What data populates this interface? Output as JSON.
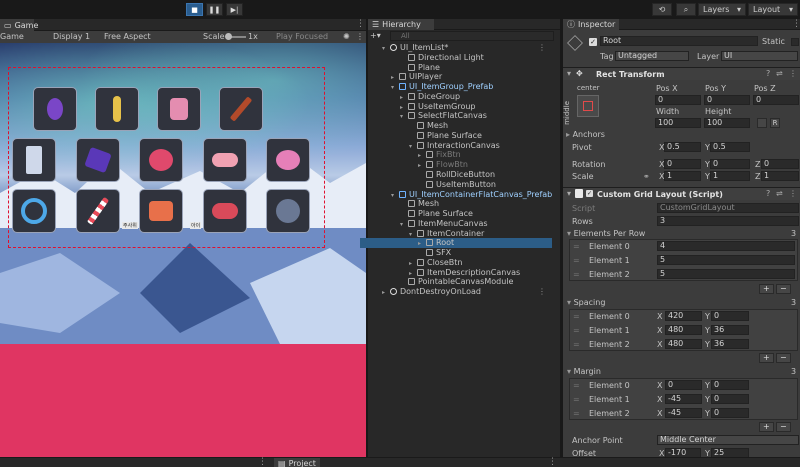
{
  "toolbar": {
    "layers_label": "Layers",
    "layout_label": "Layout"
  },
  "game": {
    "tab_label": "Game",
    "display": "Display 1",
    "aspect": "Free Aspect",
    "scale_label": "Scale",
    "scale_value": "1x",
    "play_focused": "Play Focused",
    "mode_label": "Game"
  },
  "items": {
    "rows": [
      [
        "potion",
        "spoon",
        "bottle",
        "brush"
      ],
      [
        "crystal",
        "gem",
        "cake",
        "candy",
        "ball"
      ],
      [
        "ring",
        "candy-cane",
        "cushion",
        "creature",
        "orb"
      ]
    ],
    "caption_a": "주사위",
    "caption_b": "아이"
  },
  "hierarchy": {
    "tab_label": "Hierarchy",
    "search_placeholder": "All",
    "rows": [
      {
        "label": "UI_ItemList*",
        "indent": 0,
        "arrow": "▾",
        "kind": "root",
        "sel": false,
        "dim": false
      },
      {
        "label": "Directional Light",
        "indent": 2,
        "arrow": "",
        "kind": "go",
        "sel": false,
        "dim": false
      },
      {
        "label": "Plane",
        "indent": 2,
        "arrow": "",
        "kind": "go",
        "sel": false,
        "dim": false
      },
      {
        "label": "UIPlayer",
        "indent": 1,
        "arrow": "▸",
        "kind": "go",
        "sel": false,
        "dim": false
      },
      {
        "label": "UI_ItemGroup_Prefab",
        "indent": 1,
        "arrow": "▾",
        "kind": "prefab",
        "sel": false,
        "dim": false
      },
      {
        "label": "DiceGroup",
        "indent": 2,
        "arrow": "▸",
        "kind": "go",
        "sel": false,
        "dim": false
      },
      {
        "label": "UseItemGroup",
        "indent": 2,
        "arrow": "▸",
        "kind": "go",
        "sel": false,
        "dim": false
      },
      {
        "label": "SelectFlatCanvas",
        "indent": 2,
        "arrow": "▾",
        "kind": "go",
        "sel": false,
        "dim": false
      },
      {
        "label": "Mesh",
        "indent": 3,
        "arrow": "",
        "kind": "go",
        "sel": false,
        "dim": false
      },
      {
        "label": "Plane Surface",
        "indent": 3,
        "arrow": "",
        "kind": "go",
        "sel": false,
        "dim": false
      },
      {
        "label": "InteractionCanvas",
        "indent": 3,
        "arrow": "▾",
        "kind": "go",
        "sel": false,
        "dim": false
      },
      {
        "label": "FixBtn",
        "indent": 4,
        "arrow": "▸",
        "kind": "go",
        "sel": false,
        "dim": true
      },
      {
        "label": "FlowBtn",
        "indent": 4,
        "arrow": "▸",
        "kind": "go",
        "sel": false,
        "dim": true
      },
      {
        "label": "RollDiceButton",
        "indent": 4,
        "arrow": "",
        "kind": "go",
        "sel": false,
        "dim": false
      },
      {
        "label": "UseItemButton",
        "indent": 4,
        "arrow": "",
        "kind": "go",
        "sel": false,
        "dim": false
      },
      {
        "label": "UI_ItemContainerFlatCanvas_Prefab",
        "indent": 1,
        "arrow": "▾",
        "kind": "prefab",
        "sel": false,
        "dim": false
      },
      {
        "label": "Mesh",
        "indent": 2,
        "arrow": "",
        "kind": "go",
        "sel": false,
        "dim": false
      },
      {
        "label": "Plane Surface",
        "indent": 2,
        "arrow": "",
        "kind": "go",
        "sel": false,
        "dim": false
      },
      {
        "label": "ItemMenuCanvas",
        "indent": 2,
        "arrow": "▾",
        "kind": "go",
        "sel": false,
        "dim": false
      },
      {
        "label": "ItemContainer",
        "indent": 3,
        "arrow": "▾",
        "kind": "go",
        "sel": false,
        "dim": false
      },
      {
        "label": "Root",
        "indent": 4,
        "arrow": "▸",
        "kind": "go",
        "sel": true,
        "dim": false
      },
      {
        "label": "SFX",
        "indent": 4,
        "arrow": "",
        "kind": "go",
        "sel": false,
        "dim": false
      },
      {
        "label": "CloseBtn",
        "indent": 3,
        "arrow": "▸",
        "kind": "go",
        "sel": false,
        "dim": false
      },
      {
        "label": "ItemDescriptionCanvas",
        "indent": 3,
        "arrow": "▸",
        "kind": "go",
        "sel": false,
        "dim": false
      },
      {
        "label": "PointableCanvasModule",
        "indent": 2,
        "arrow": "",
        "kind": "go",
        "sel": false,
        "dim": false
      },
      {
        "label": "DontDestroyOnLoad",
        "indent": 0,
        "arrow": "▸",
        "kind": "root",
        "sel": false,
        "dim": false
      }
    ]
  },
  "inspector": {
    "tab_label": "Inspector",
    "object_name": "Root",
    "static_label": "Static",
    "tag_label": "Tag",
    "tag_value": "Untagged",
    "layer_label": "Layer",
    "layer_value": "UI",
    "rect": {
      "title": "Rect Transform",
      "anchor_h": "center",
      "anchor_v": "middle",
      "h_posx": "Pos X",
      "h_posy": "Pos Y",
      "h_posz": "Pos Z",
      "posx": "0",
      "posy": "0",
      "posz": "0",
      "h_width": "Width",
      "h_height": "Height",
      "width": "100",
      "height": "100",
      "r_btn": "R",
      "anchors_label": "Anchors",
      "pivot_label": "Pivot",
      "pivot_x": "0.5",
      "pivot_y": "0.5",
      "rotation_label": "Rotation",
      "rot_x": "0",
      "rot_y": "0",
      "rot_z": "0",
      "scale_label": "Scale",
      "scale_x": "1",
      "scale_y": "1",
      "scale_z": "1",
      "axis_x": "X",
      "axis_y": "Y",
      "axis_z": "Z"
    },
    "grid": {
      "title": "Custom Grid Layout (Script)",
      "script_label": "Script",
      "script_value": "CustomGridLayout",
      "rows_label": "Rows",
      "rows_value": "3",
      "epr_label": "Elements Per Row",
      "epr_count": "3",
      "epr": [
        {
          "label": "Element 0",
          "value": "4"
        },
        {
          "label": "Element 1",
          "value": "5"
        },
        {
          "label": "Element 2",
          "value": "5"
        }
      ],
      "spacing_label": "Spacing",
      "spacing_count": "3",
      "spacing": [
        {
          "label": "Element 0",
          "x": "420",
          "y": "0"
        },
        {
          "label": "Element 1",
          "x": "480",
          "y": "36"
        },
        {
          "label": "Element 2",
          "x": "480",
          "y": "36"
        }
      ],
      "margin_label": "Margin",
      "margin_count": "3",
      "margin": [
        {
          "label": "Element 0",
          "x": "0",
          "y": "0"
        },
        {
          "label": "Element 1",
          "x": "-45",
          "y": "0"
        },
        {
          "label": "Element 2",
          "x": "-45",
          "y": "0"
        }
      ],
      "anchor_point_label": "Anchor Point",
      "anchor_point_value": "Middle Center",
      "offset_label": "Offset",
      "offset_x": "-170",
      "offset_y": "25"
    }
  },
  "project": {
    "tab_label": "Project"
  },
  "colors": {
    "selection": "#2c5d87",
    "pink_area": "#e03562",
    "dash": "#e0102e",
    "play_active": "#2a5d8f"
  }
}
